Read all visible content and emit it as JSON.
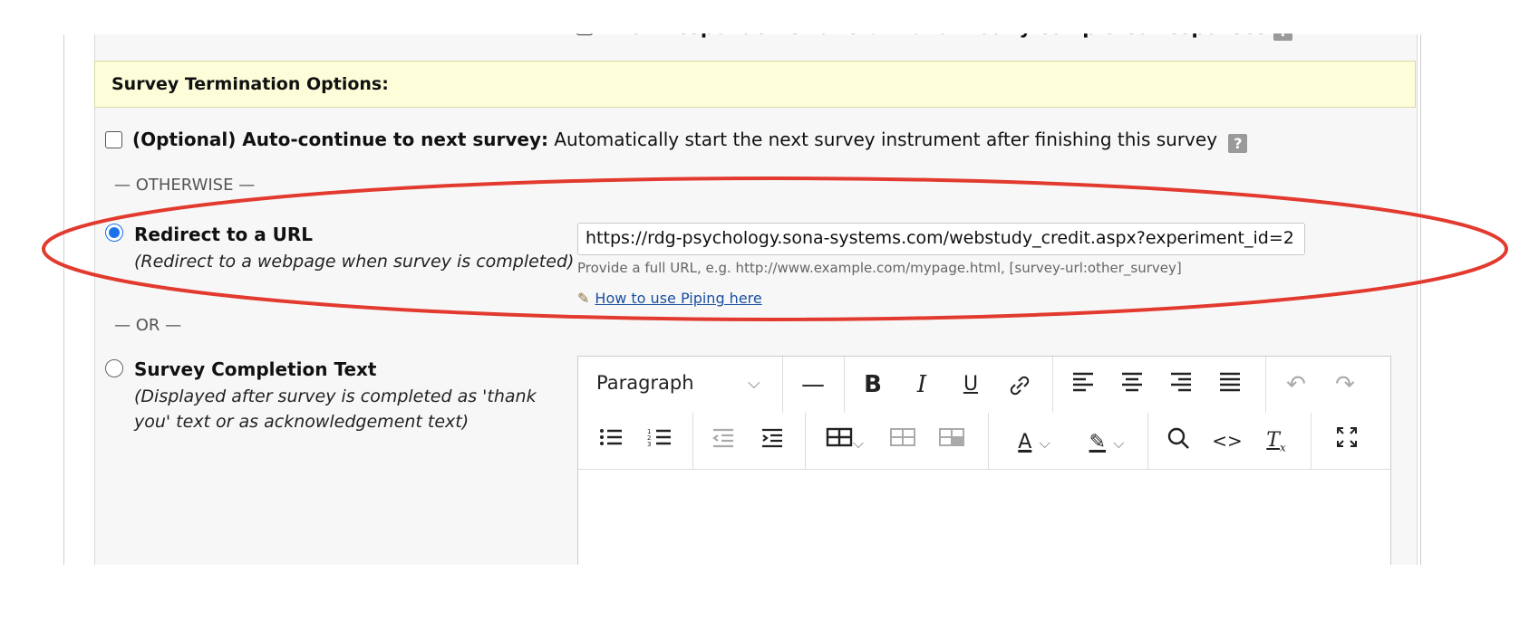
{
  "top_option": {
    "label": "Allow respondents to return and modify completed responses",
    "help": "?"
  },
  "section": {
    "title": "Survey Termination Options:"
  },
  "auto_continue": {
    "label_bold": "(Optional) Auto-continue to next survey:",
    "label_rest": " Automatically start the next survey instrument after finishing this survey",
    "help": "?",
    "checked": false
  },
  "separator_otherwise": "— OTHERWISE —",
  "redirect": {
    "title": "Redirect to a URL",
    "description": "(Redirect to a webpage when survey is completed)",
    "selected": true,
    "url_value": "https://rdg-psychology.sona-systems.com/webstudy_credit.aspx?experiment_id=2",
    "hint": "Provide a full URL, e.g. http://www.example.com/mypage.html, [survey-url:other_survey]",
    "piping_link": "How to use Piping here"
  },
  "separator_or": "— OR —",
  "completion_text": {
    "title": "Survey Completion Text",
    "description": "(Displayed after survey is completed as 'thank you' text or as acknowledgement text)",
    "selected": false
  },
  "editor": {
    "block_format": "Paragraph",
    "toolbar_row1": [
      "block-format",
      "horizontal-rule",
      "bold",
      "italic",
      "underline",
      "link",
      "align-left",
      "align-center",
      "align-right",
      "justify",
      "undo",
      "redo"
    ],
    "toolbar_row2": [
      "bullet-list",
      "numbered-list",
      "outdent",
      "indent",
      "table",
      "table-row",
      "table-cell",
      "text-color",
      "highlight-color",
      "search",
      "source-code",
      "clear-format",
      "fullscreen"
    ]
  },
  "annotation": {
    "color": "#e23a2e"
  }
}
